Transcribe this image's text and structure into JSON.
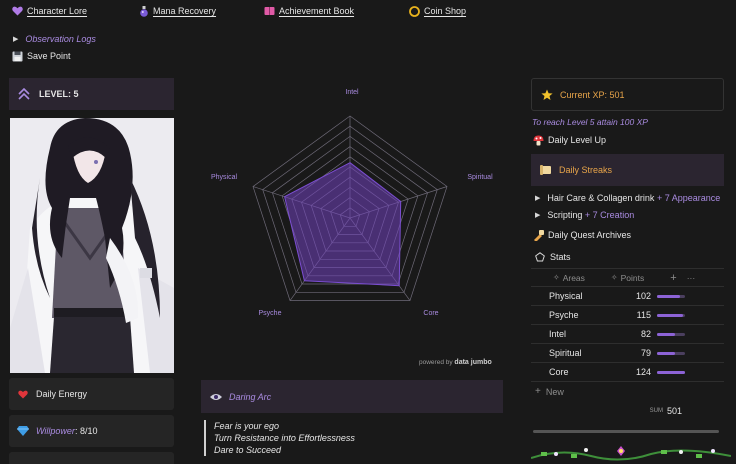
{
  "topnav": [
    {
      "label": "Character Lore",
      "icon": "purple-heart-icon"
    },
    {
      "label": "Mana Recovery",
      "icon": "potion-icon"
    },
    {
      "label": "Achievement Book",
      "icon": "book-icon"
    },
    {
      "label": "Coin Shop",
      "icon": "coin-icon"
    }
  ],
  "observation_logs": "Observation Logs",
  "save_point": "Save Point",
  "level": "LEVEL: 5",
  "daily_energy": "Daily Energy",
  "willpower_label": "Willpower",
  "willpower_value": ": 8/10",
  "radar": {
    "labels": [
      "Intel",
      "Spiritual",
      "Core",
      "Psyche",
      "Physical"
    ],
    "powered_by": "powered by",
    "brand": "data jumbo"
  },
  "chart_data": {
    "type": "radar",
    "categories": [
      "Intel",
      "Spiritual",
      "Core",
      "Psyche",
      "Physical"
    ],
    "values": [
      82,
      79,
      124,
      115,
      102
    ]
  },
  "daring_arc": {
    "title": "Daring Arc",
    "lines": [
      "Fear is your ego",
      "Turn Resistance into Effortlessness",
      "Dare to Succeed"
    ]
  },
  "xp": {
    "label": "Current XP: 501"
  },
  "reach_text": "To reach Level 5 attain 100 XP",
  "daily_level_up": "Daily Level Up",
  "daily_streaks": "Daily Streaks",
  "streaks": [
    {
      "label": "Hair Care & Collagen drink",
      "bonus": "+ 7 Appearance"
    },
    {
      "label": "Scripting",
      "bonus": "+ 7 Creation"
    }
  ],
  "daily_quest_archives": "Daily Quest Archives",
  "stats": {
    "title": "Stats",
    "col_areas": "Areas",
    "col_points": "Points",
    "add": "+",
    "more": "···",
    "rows": [
      {
        "area": "Physical",
        "points": "102",
        "fill": 0.82
      },
      {
        "area": "Psyche",
        "points": "115",
        "fill": 0.93
      },
      {
        "area": "Intel",
        "points": "82",
        "fill": 0.66
      },
      {
        "area": "Spiritual",
        "points": "79",
        "fill": 0.64
      },
      {
        "area": "Core",
        "points": "124",
        "fill": 1.0
      }
    ],
    "new": "New",
    "sum_label": "SUM",
    "sum_value": "501"
  }
}
